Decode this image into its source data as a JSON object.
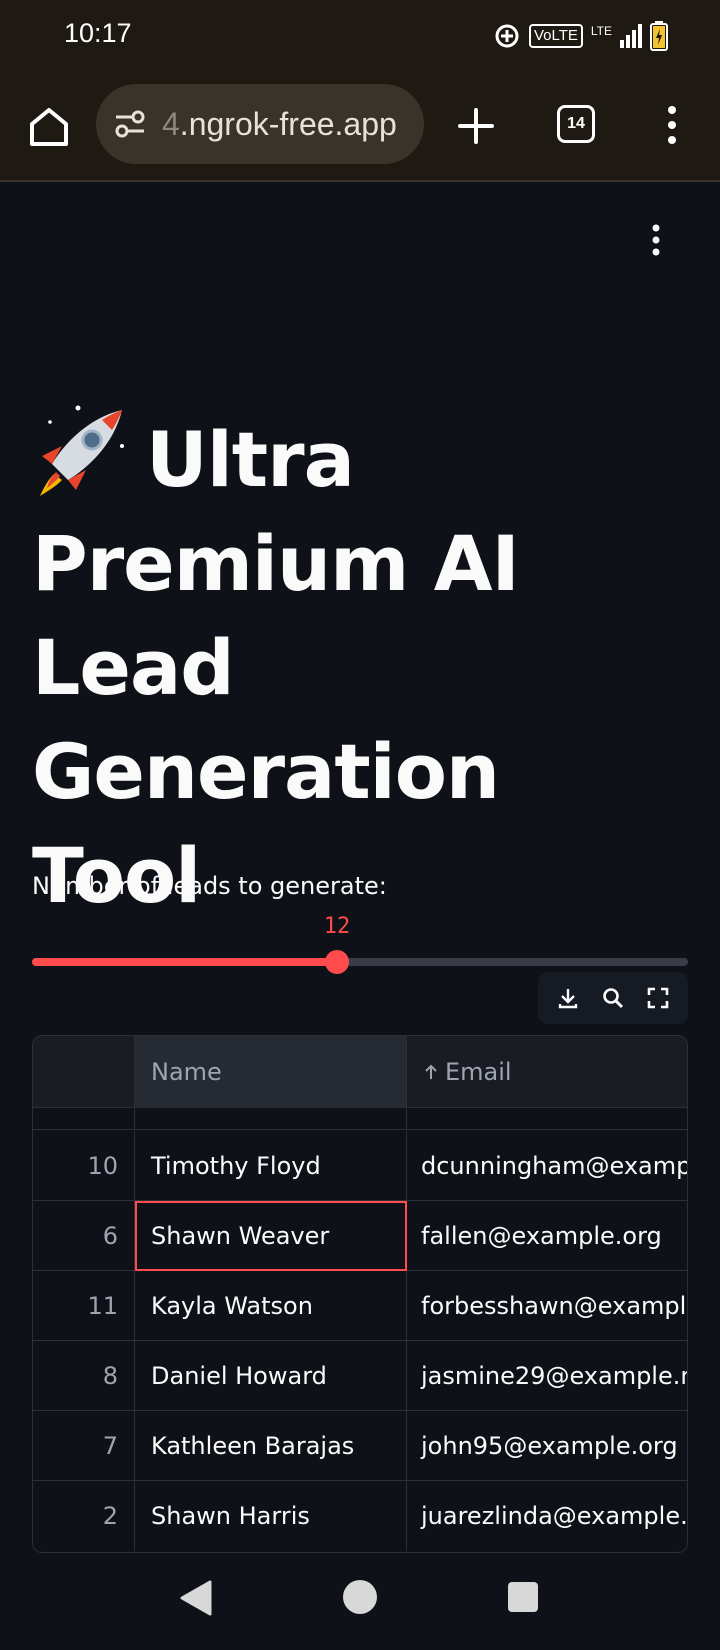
{
  "status_bar": {
    "time": "10:17",
    "volte": "VoLTE",
    "lte": "LTE",
    "icons": [
      "location-target-icon",
      "volte-icon",
      "signal-icon",
      "battery-charging-icon"
    ]
  },
  "browser": {
    "url_faded": "4",
    "url_main": ".ngrok-free.app",
    "tab_count": "14",
    "icons": [
      "home-icon",
      "site-settings-icon",
      "plus-icon",
      "tabs-icon",
      "more-vertical-icon"
    ]
  },
  "app": {
    "title": "Ultra Premium AI Lead Generation Tool",
    "title_icon": "rocket-icon",
    "accent_color": "#ff4b4b",
    "background_color": "#0e1117"
  },
  "slider": {
    "label": "Number of leads to generate:",
    "value": "12",
    "fill_fraction": 0.465
  },
  "table": {
    "toolbar_icons": [
      "download-icon",
      "search-icon",
      "fullscreen-icon"
    ],
    "columns": {
      "index": "",
      "name": "Name",
      "email": "Email"
    },
    "sorted_column": "Email",
    "sort_direction": "ascending",
    "rows": [
      {
        "index": "10",
        "name": "Timothy Floyd",
        "email": "dcunningham@examp"
      },
      {
        "index": "6",
        "name": "Shawn Weaver",
        "email": "fallen@example.org",
        "selected_cell": "name"
      },
      {
        "index": "11",
        "name": "Kayla Watson",
        "email": "forbesshawn@exampl"
      },
      {
        "index": "8",
        "name": "Daniel Howard",
        "email": "jasmine29@example.n"
      },
      {
        "index": "7",
        "name": "Kathleen Barajas",
        "email": "john95@example.org"
      },
      {
        "index": "2",
        "name": "Shawn Harris",
        "email": "juarezlinda@example."
      }
    ]
  },
  "nav_bar": {
    "icons": [
      "back-icon",
      "home-circle-icon",
      "recents-icon"
    ]
  }
}
